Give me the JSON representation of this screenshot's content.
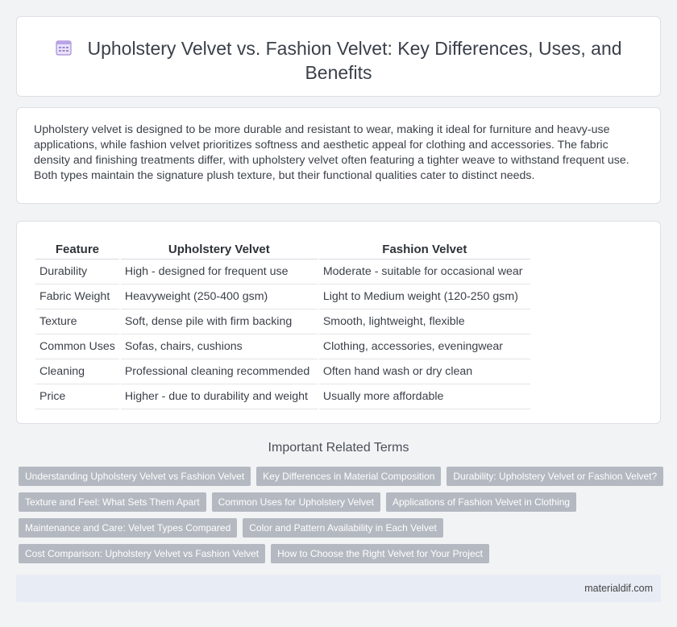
{
  "header": {
    "title": "Upholstery Velvet vs. Fashion Velvet: Key Differences, Uses, and Benefits",
    "icon": "document-icon"
  },
  "intro": {
    "text": "Upholstery velvet is designed to be more durable and resistant to wear, making it ideal for furniture and heavy-use applications, while fashion velvet prioritizes softness and aesthetic appeal for clothing and accessories. The fabric density and finishing treatments differ, with upholstery velvet often featuring a tighter weave to withstand frequent use. Both types maintain the signature plush texture, but their functional qualities cater to distinct needs."
  },
  "comparison": {
    "headers": [
      "Feature",
      "Upholstery Velvet",
      "Fashion Velvet"
    ],
    "rows": [
      [
        "Durability",
        "High - designed for frequent use",
        "Moderate - suitable for occasional wear"
      ],
      [
        "Fabric Weight",
        "Heavyweight (250-400 gsm)",
        "Light to Medium weight (120-250 gsm)"
      ],
      [
        "Texture",
        "Soft, dense pile with firm backing",
        "Smooth, lightweight, flexible"
      ],
      [
        "Common Uses",
        "Sofas, chairs, cushions",
        "Clothing, accessories, eveningwear"
      ],
      [
        "Cleaning",
        "Professional cleaning recommended",
        "Often hand wash or dry clean"
      ],
      [
        "Price",
        "Higher - due to durability and weight",
        "Usually more affordable"
      ]
    ]
  },
  "related": {
    "heading": "Important Related Terms",
    "terms": [
      "Understanding Upholstery Velvet vs Fashion Velvet",
      "Key Differences in Material Composition",
      "Durability: Upholstery Velvet or Fashion Velvet?",
      "Texture and Feel: What Sets Them Apart",
      "Common Uses for Upholstery Velvet",
      "Applications of Fashion Velvet in Clothing",
      "Maintenance and Care: Velvet Types Compared",
      "Color and Pattern Availability in Each Velvet",
      "Cost Comparison: Upholstery Velvet vs Fashion Velvet",
      "How to Choose the Right Velvet for Your Project"
    ]
  },
  "footer": {
    "site": "materialdif.com"
  },
  "colors": {
    "chip_bg": "#b4b9c1",
    "footer_bg": "#e8ecf5",
    "icon_accent": "#a78bdb"
  }
}
